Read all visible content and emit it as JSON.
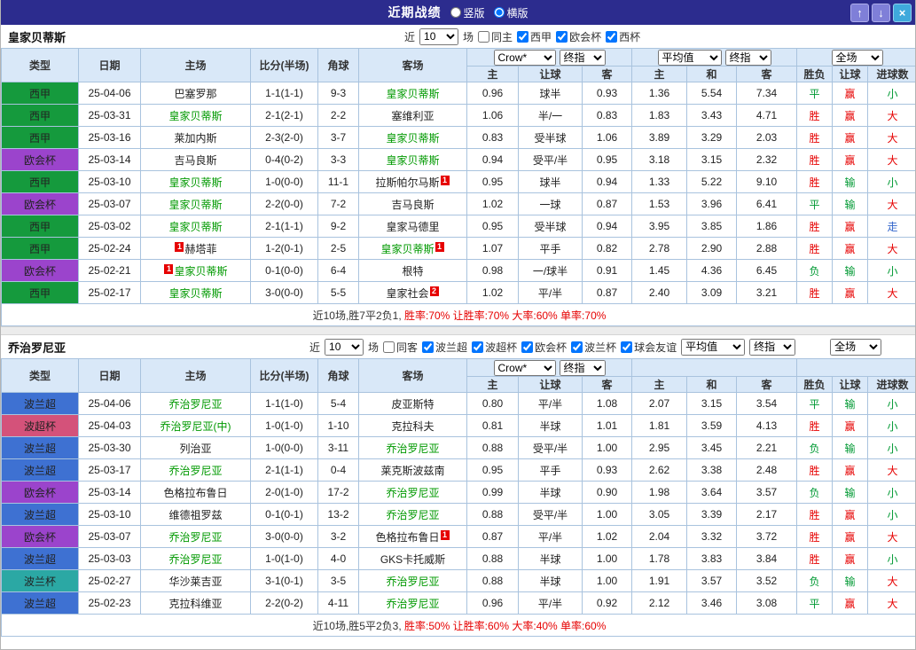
{
  "topbar": {
    "title": "近期战绩",
    "radios": [
      {
        "label": "竖版",
        "checked": false
      },
      {
        "label": "横版",
        "checked": true
      }
    ],
    "buttons": {
      "up": "↑",
      "down": "↓",
      "close": "×"
    }
  },
  "columns": {
    "main": [
      "类型",
      "日期",
      "主场",
      "比分(半场)",
      "角球",
      "客场"
    ],
    "asia": [
      "主",
      "让球",
      "客"
    ],
    "europe": [
      "主",
      "和",
      "客"
    ],
    "results": [
      "胜负",
      "让球",
      "进球数"
    ]
  },
  "league_colors": {
    "西甲": "#159a3d",
    "欧会杯": "#9b44cc",
    "波兰超": "#3e71d2",
    "波超杯": "#d4527a",
    "波兰杯": "#2ba8a4"
  },
  "result_colors": {
    "胜": "#e60000",
    "平": "#009933",
    "负": "#009933",
    "赢": "#e60000",
    "输": "#009933",
    "走": "#3366cc",
    "大": "#e60000",
    "小": "#009933"
  },
  "sections": [
    {
      "team": "皇家贝蒂斯",
      "filters": {
        "prefix": "近",
        "count": "10",
        "suffix": "场",
        "venue": {
          "label": "同主",
          "checked": false
        },
        "leagues": [
          {
            "label": "西甲",
            "checked": true
          },
          {
            "label": "欧会杯",
            "checked": true
          },
          {
            "label": "西杯",
            "checked": true
          }
        ]
      },
      "selects": {
        "source": "Crow*",
        "source_kind": "终指",
        "avg": "平均值",
        "avg_kind": "终指",
        "scope": "全场"
      },
      "rows": [
        {
          "league": "西甲",
          "date": "25-04-06",
          "home": {
            "name": "巴塞罗那"
          },
          "score": "1-1(1-1)",
          "corners": "9-3",
          "away": {
            "name": "皇家贝蒂斯",
            "focus": true
          },
          "asia": [
            "0.96",
            "球半",
            "0.93"
          ],
          "euro": [
            "1.36",
            "5.54",
            "7.34"
          ],
          "res": [
            "平",
            "赢",
            "小"
          ]
        },
        {
          "league": "西甲",
          "date": "25-03-31",
          "home": {
            "name": "皇家贝蒂斯",
            "focus": true
          },
          "score": "2-1(2-1)",
          "corners": "2-2",
          "away": {
            "name": "塞维利亚"
          },
          "asia": [
            "1.06",
            "半/一",
            "0.83"
          ],
          "euro": [
            "1.83",
            "3.43",
            "4.71"
          ],
          "res": [
            "胜",
            "赢",
            "大"
          ]
        },
        {
          "league": "西甲",
          "date": "25-03-16",
          "home": {
            "name": "莱加内斯"
          },
          "score": "2-3(2-0)",
          "corners": "3-7",
          "away": {
            "name": "皇家贝蒂斯",
            "focus": true
          },
          "asia": [
            "0.83",
            "受半球",
            "1.06"
          ],
          "euro": [
            "3.89",
            "3.29",
            "2.03"
          ],
          "res": [
            "胜",
            "赢",
            "大"
          ]
        },
        {
          "league": "欧会杯",
          "date": "25-03-14",
          "home": {
            "name": "吉马良斯"
          },
          "score": "0-4(0-2)",
          "corners": "3-3",
          "away": {
            "name": "皇家贝蒂斯",
            "focus": true
          },
          "asia": [
            "0.94",
            "受平/半",
            "0.95"
          ],
          "euro": [
            "3.18",
            "3.15",
            "2.32"
          ],
          "res": [
            "胜",
            "赢",
            "大"
          ]
        },
        {
          "league": "西甲",
          "date": "25-03-10",
          "home": {
            "name": "皇家贝蒂斯",
            "focus": true
          },
          "score": "1-0(0-0)",
          "corners": "11-1",
          "away": {
            "name": "拉斯帕尔马斯",
            "post_badge": "1"
          },
          "asia": [
            "0.95",
            "球半",
            "0.94"
          ],
          "euro": [
            "1.33",
            "5.22",
            "9.10"
          ],
          "res": [
            "胜",
            "输",
            "小"
          ]
        },
        {
          "league": "欧会杯",
          "date": "25-03-07",
          "home": {
            "name": "皇家贝蒂斯",
            "focus": true
          },
          "score": "2-2(0-0)",
          "corners": "7-2",
          "away": {
            "name": "吉马良斯"
          },
          "asia": [
            "1.02",
            "一球",
            "0.87"
          ],
          "euro": [
            "1.53",
            "3.96",
            "6.41"
          ],
          "res": [
            "平",
            "输",
            "大"
          ]
        },
        {
          "league": "西甲",
          "date": "25-03-02",
          "home": {
            "name": "皇家贝蒂斯",
            "focus": true
          },
          "score": "2-1(1-1)",
          "corners": "9-2",
          "away": {
            "name": "皇家马德里"
          },
          "asia": [
            "0.95",
            "受半球",
            "0.94"
          ],
          "euro": [
            "3.95",
            "3.85",
            "1.86"
          ],
          "res": [
            "胜",
            "赢",
            "走"
          ]
        },
        {
          "league": "西甲",
          "date": "25-02-24",
          "home": {
            "name": "赫塔菲",
            "pre_badge": "1"
          },
          "score": "1-2(0-1)",
          "corners": "2-5",
          "away": {
            "name": "皇家贝蒂斯",
            "focus": true,
            "post_badge": "1"
          },
          "asia": [
            "1.07",
            "平手",
            "0.82"
          ],
          "euro": [
            "2.78",
            "2.90",
            "2.88"
          ],
          "res": [
            "胜",
            "赢",
            "大"
          ]
        },
        {
          "league": "欧会杯",
          "date": "25-02-21",
          "home": {
            "name": "皇家贝蒂斯",
            "focus": true,
            "pre_badge": "1"
          },
          "score": "0-1(0-0)",
          "corners": "6-4",
          "away": {
            "name": "根特"
          },
          "asia": [
            "0.98",
            "一/球半",
            "0.91"
          ],
          "euro": [
            "1.45",
            "4.36",
            "6.45"
          ],
          "res": [
            "负",
            "输",
            "小"
          ]
        },
        {
          "league": "西甲",
          "date": "25-02-17",
          "home": {
            "name": "皇家贝蒂斯",
            "focus": true
          },
          "score": "3-0(0-0)",
          "corners": "5-5",
          "away": {
            "name": "皇家社会",
            "post_badge": "2"
          },
          "asia": [
            "1.02",
            "平/半",
            "0.87"
          ],
          "euro": [
            "2.40",
            "3.09",
            "3.21"
          ],
          "res": [
            "胜",
            "赢",
            "大"
          ]
        }
      ],
      "summary": [
        {
          "text": "近10场,胜7平2负1, ",
          "color": "#333333"
        },
        {
          "text": "胜率:70% 让胜率:70% 大率:60% 单率:70%",
          "color": "#e60000"
        }
      ]
    },
    {
      "team": "乔治罗尼亚",
      "filters": {
        "prefix": "近",
        "count": "10",
        "suffix": "场",
        "venue": {
          "label": "同客",
          "checked": false
        },
        "leagues": [
          {
            "label": "波兰超",
            "checked": true
          },
          {
            "label": "波超杯",
            "checked": true
          },
          {
            "label": "欧会杯",
            "checked": true
          },
          {
            "label": "波兰杯",
            "checked": true
          },
          {
            "label": "球会友谊",
            "checked": true
          }
        ]
      },
      "selects": {
        "source": "Crow*",
        "source_kind": "终指",
        "avg": "平均值",
        "avg_kind": "终指",
        "scope": "全场"
      },
      "rows": [
        {
          "league": "波兰超",
          "date": "25-04-06",
          "home": {
            "name": "乔治罗尼亚",
            "focus": true
          },
          "score": "1-1(1-0)",
          "corners": "5-4",
          "away": {
            "name": "皮亚斯特"
          },
          "asia": [
            "0.80",
            "平/半",
            "1.08"
          ],
          "euro": [
            "2.07",
            "3.15",
            "3.54"
          ],
          "res": [
            "平",
            "输",
            "小"
          ]
        },
        {
          "league": "波超杯",
          "date": "25-04-03",
          "home": {
            "name": "乔治罗尼亚(中)",
            "focus": true
          },
          "score": "1-0(1-0)",
          "corners": "1-10",
          "away": {
            "name": "克拉科夫"
          },
          "asia": [
            "0.81",
            "半球",
            "1.01"
          ],
          "euro": [
            "1.81",
            "3.59",
            "4.13"
          ],
          "res": [
            "胜",
            "赢",
            "小"
          ]
        },
        {
          "league": "波兰超",
          "date": "25-03-30",
          "home": {
            "name": "列治亚"
          },
          "score": "1-0(0-0)",
          "corners": "3-11",
          "away": {
            "name": "乔治罗尼亚",
            "focus": true
          },
          "asia": [
            "0.88",
            "受平/半",
            "1.00"
          ],
          "euro": [
            "2.95",
            "3.45",
            "2.21"
          ],
          "res": [
            "负",
            "输",
            "小"
          ]
        },
        {
          "league": "波兰超",
          "date": "25-03-17",
          "home": {
            "name": "乔治罗尼亚",
            "focus": true
          },
          "score": "2-1(1-1)",
          "corners": "0-4",
          "away": {
            "name": "莱克斯波兹南"
          },
          "asia": [
            "0.95",
            "平手",
            "0.93"
          ],
          "euro": [
            "2.62",
            "3.38",
            "2.48"
          ],
          "res": [
            "胜",
            "赢",
            "大"
          ]
        },
        {
          "league": "欧会杯",
          "date": "25-03-14",
          "home": {
            "name": "色格拉布鲁日"
          },
          "score": "2-0(1-0)",
          "corners": "17-2",
          "away": {
            "name": "乔治罗尼亚",
            "focus": true
          },
          "asia": [
            "0.99",
            "半球",
            "0.90"
          ],
          "euro": [
            "1.98",
            "3.64",
            "3.57"
          ],
          "res": [
            "负",
            "输",
            "小"
          ]
        },
        {
          "league": "波兰超",
          "date": "25-03-10",
          "home": {
            "name": "维德祖罗兹"
          },
          "score": "0-1(0-1)",
          "corners": "13-2",
          "away": {
            "name": "乔治罗尼亚",
            "focus": true
          },
          "asia": [
            "0.88",
            "受平/半",
            "1.00"
          ],
          "euro": [
            "3.05",
            "3.39",
            "2.17"
          ],
          "res": [
            "胜",
            "赢",
            "小"
          ]
        },
        {
          "league": "欧会杯",
          "date": "25-03-07",
          "home": {
            "name": "乔治罗尼亚",
            "focus": true
          },
          "score": "3-0(0-0)",
          "corners": "3-2",
          "away": {
            "name": "色格拉布鲁日",
            "post_badge": "1"
          },
          "asia": [
            "0.87",
            "平/半",
            "1.02"
          ],
          "euro": [
            "2.04",
            "3.32",
            "3.72"
          ],
          "res": [
            "胜",
            "赢",
            "大"
          ]
        },
        {
          "league": "波兰超",
          "date": "25-03-03",
          "home": {
            "name": "乔治罗尼亚",
            "focus": true
          },
          "score": "1-0(1-0)",
          "corners": "4-0",
          "away": {
            "name": "GKS卡托威斯"
          },
          "asia": [
            "0.88",
            "半球",
            "1.00"
          ],
          "euro": [
            "1.78",
            "3.83",
            "3.84"
          ],
          "res": [
            "胜",
            "赢",
            "小"
          ]
        },
        {
          "league": "波兰杯",
          "date": "25-02-27",
          "home": {
            "name": "华沙莱吉亚"
          },
          "score": "3-1(0-1)",
          "corners": "3-5",
          "away": {
            "name": "乔治罗尼亚",
            "focus": true
          },
          "asia": [
            "0.88",
            "半球",
            "1.00"
          ],
          "euro": [
            "1.91",
            "3.57",
            "3.52"
          ],
          "res": [
            "负",
            "输",
            "大"
          ]
        },
        {
          "league": "波兰超",
          "date": "25-02-23",
          "home": {
            "name": "克拉科维亚"
          },
          "score": "2-2(0-2)",
          "corners": "4-11",
          "away": {
            "name": "乔治罗尼亚",
            "focus": true
          },
          "asia": [
            "0.96",
            "平/半",
            "0.92"
          ],
          "euro": [
            "2.12",
            "3.46",
            "3.08"
          ],
          "res": [
            "平",
            "赢",
            "大"
          ]
        }
      ],
      "summary": [
        {
          "text": "近10场,胜5平2负3, ",
          "color": "#333333"
        },
        {
          "text": "胜率:50% 让胜率:60% 大率:40% 单率:60%",
          "color": "#e60000"
        }
      ]
    }
  ]
}
